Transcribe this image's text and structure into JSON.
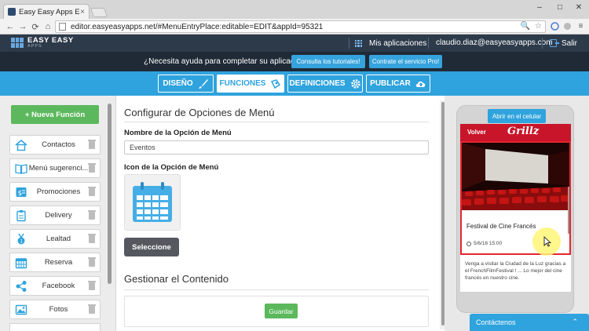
{
  "browser": {
    "tab_title": "Easy Easy Apps Editor",
    "tab_close": "×",
    "url": "editor.easyeasyapps.net/#MenuEntryPlace:editable=EDIT&appId=95321",
    "window_controls": {
      "minimize": "–",
      "maximize": "□",
      "close": "✕"
    },
    "nav_glyphs": {
      "back": "←",
      "forward": "→",
      "reload": "⟳",
      "home": "⌂",
      "menu": "≡",
      "star": "☆",
      "search": "🔍"
    }
  },
  "app": {
    "logo_text": "EASY EASY",
    "logo_sub": "APPS",
    "my_apps": "Mis aplicaciones",
    "user_email": "claudio.diaz@easyeasyapps.com",
    "logout": "Salir"
  },
  "help": {
    "question": "¿Necesita ayuda para completar su aplicación?",
    "tutorials_button": "Consulta los tutoriales!",
    "pro_button": "Contrate el servicio Pro!"
  },
  "steps": [
    {
      "label": "DISEÑO",
      "icon": "brush-icon"
    },
    {
      "label": "FUNCIONES",
      "icon": "puzzle-icon",
      "active": true
    },
    {
      "label": "DEFINICIONES",
      "icon": "gear-icon"
    },
    {
      "label": "PUBLICAR",
      "icon": "cloud-upload-icon"
    }
  ],
  "sidebar": {
    "new_function": "+ Nueva Función",
    "items": [
      {
        "label": "Contactos",
        "icon": "house-icon"
      },
      {
        "label": "Menú sugerenci...",
        "icon": "book-icon"
      },
      {
        "label": "Promociones",
        "icon": "price-tag-icon"
      },
      {
        "label": "Delivery",
        "icon": "clipboard-icon"
      },
      {
        "label": "Lealtad",
        "icon": "medal-icon"
      },
      {
        "label": "Reserva",
        "icon": "calendar-icon"
      },
      {
        "label": "Facebook",
        "icon": "share-icon"
      },
      {
        "label": "Fotos",
        "icon": "photo-icon"
      }
    ]
  },
  "main": {
    "section_title": "Configurar de Opciones de Menú",
    "name_label": "Nombre de la Opción de Menú",
    "name_value": "Eventos",
    "icon_label": "Icon de la Opción de Menú",
    "selected_icon": "calendar-icon",
    "select_button": "Seleccione",
    "manage_title": "Gestionar el Contenido",
    "save_button": "Guardar"
  },
  "preview": {
    "open_phone_button": "Abrir en el celular",
    "back_label": "Volver",
    "brand": "Grillz",
    "event_title": "Festival de Cine Francés",
    "event_date": "5/6/16 15:00",
    "event_description": "Venga a visitar la Ciudad de la Luz gracias a el FrenchFilmFestival ! ... Lo mejor del cine francés en nuestro cine.",
    "contact_bar": "Contáctenos",
    "contact_chevron": "⌃"
  },
  "colors": {
    "accent_blue": "#2fa3dd",
    "green": "#5cb85c",
    "header_dark": "#2d3a4a",
    "brand_red": "#c8152a"
  }
}
